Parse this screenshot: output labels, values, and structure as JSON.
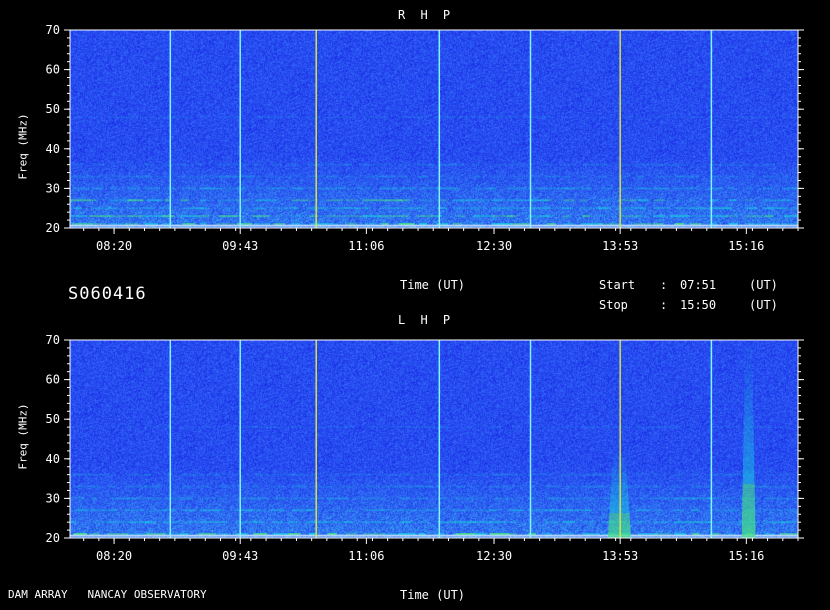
{
  "header": {
    "date_code": "S060416",
    "time_label": "Time (UT)",
    "start_label": "Start",
    "start_sep": ":",
    "start_value": "07:51",
    "start_unit": "(UT)",
    "stop_label": "Stop",
    "stop_sep": ":",
    "stop_value": "15:50",
    "stop_unit": "(UT)"
  },
  "footer": {
    "credit": "DAM ARRAY   NANCAY OBSERVATORY",
    "time_label": "Time (UT)"
  },
  "colors": {
    "background": "#000000",
    "spectrogram_base": "#1a2ee6",
    "spectrogram_noise": "#2a6ef2",
    "band_emission": "#19c9e0",
    "green_emission": "#44e08a",
    "yellow_marker": "#d7e04a",
    "cyan_marker": "#7ff5ff",
    "axis": "#ffffff"
  },
  "chart_data": [
    {
      "type": "heatmap",
      "title": "R H P",
      "ylabel": "Freq (MHz)",
      "xlabel": "",
      "ylim": [
        20,
        70
      ],
      "yticks": [
        20,
        30,
        40,
        50,
        60,
        70
      ],
      "xrange_ut": [
        "07:51",
        "15:50"
      ],
      "xticks": [
        "08:20",
        "09:43",
        "11:06",
        "12:30",
        "13:53",
        "15:16"
      ],
      "marker_lines_ut": [
        {
          "time": "08:57",
          "color": "cyan"
        },
        {
          "time": "09:43",
          "color": "cyan"
        },
        {
          "time": "10:33",
          "color": "yellow"
        },
        {
          "time": "11:54",
          "color": "cyan"
        },
        {
          "time": "12:54",
          "color": "cyan"
        },
        {
          "time": "13:53",
          "color": "yellow"
        },
        {
          "time": "14:53",
          "color": "cyan"
        }
      ],
      "emission_bands_mhz": [
        {
          "freq": 21,
          "intensity": 0.9
        },
        {
          "freq": 23,
          "intensity": 0.7
        },
        {
          "freq": 25,
          "intensity": 0.6
        },
        {
          "freq": 27,
          "intensity": 0.65
        },
        {
          "freq": 30,
          "intensity": 0.45
        },
        {
          "freq": 33,
          "intensity": 0.3
        },
        {
          "freq": 36,
          "intensity": 0.25
        },
        {
          "freq": 48,
          "intensity": 0.15
        }
      ]
    },
    {
      "type": "heatmap",
      "title": "L H P",
      "ylabel": "Freq (MHz)",
      "xlabel": "Time (UT)",
      "ylim": [
        20,
        70
      ],
      "yticks": [
        20,
        30,
        40,
        50,
        60,
        70
      ],
      "xrange_ut": [
        "07:51",
        "15:50"
      ],
      "xticks": [
        "08:20",
        "09:43",
        "11:06",
        "12:30",
        "13:53",
        "15:16"
      ],
      "marker_lines_ut": [
        {
          "time": "08:57",
          "color": "cyan"
        },
        {
          "time": "09:43",
          "color": "cyan"
        },
        {
          "time": "10:33",
          "color": "yellow"
        },
        {
          "time": "11:54",
          "color": "cyan"
        },
        {
          "time": "12:54",
          "color": "cyan"
        },
        {
          "time": "13:53",
          "color": "yellow"
        },
        {
          "time": "14:53",
          "color": "cyan"
        }
      ],
      "emission_bands_mhz": [
        {
          "freq": 21,
          "intensity": 0.9
        },
        {
          "freq": 24,
          "intensity": 0.6
        },
        {
          "freq": 27,
          "intensity": 0.55
        },
        {
          "freq": 30,
          "intensity": 0.4
        },
        {
          "freq": 33,
          "intensity": 0.3
        },
        {
          "freq": 36,
          "intensity": 0.25
        },
        {
          "freq": 48,
          "intensity": 0.15
        }
      ],
      "bursts_ut": [
        {
          "start": "13:45",
          "end": "14:00",
          "fmax": 42
        },
        {
          "start": "15:13",
          "end": "15:22",
          "fmax": 68
        }
      ]
    }
  ]
}
